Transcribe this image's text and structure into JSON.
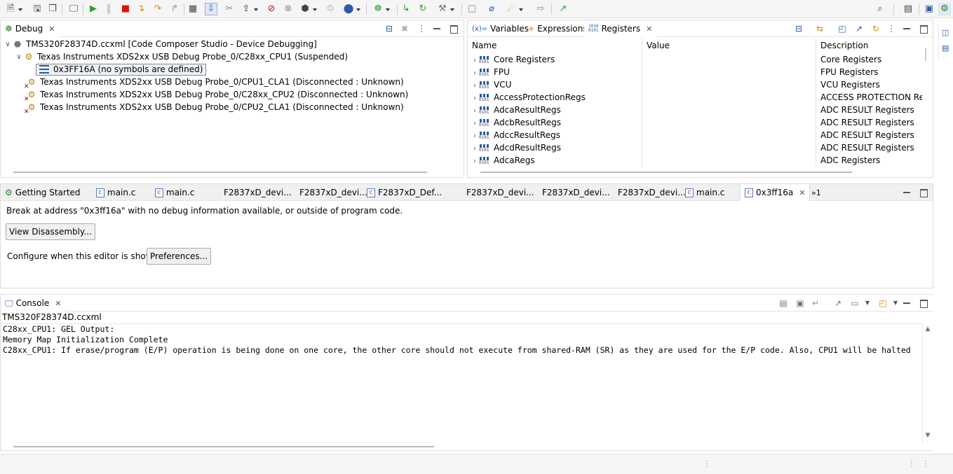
{
  "colors": {
    "accent": "#2a5aa8",
    "pane_border": "#dcdcdc",
    "toolbar_bg": "#f5f5f5",
    "editor_tab_bg": "#f0f0f0"
  },
  "debug": {
    "tab_label": "Debug",
    "root": "TMS320F28374D.ccxml [Code Composer Studio - Device Debugging]",
    "cpu1": "Texas Instruments XDS2xx USB Debug Probe_0/C28xx_CPU1 (Suspended)",
    "frame": "0x3FF16A  (no symbols are defined)",
    "cla1": "Texas Instruments XDS2xx USB Debug Probe_0/CPU1_CLA1 (Disconnected : Unknown)",
    "cpu2": "Texas Instruments XDS2xx USB Debug Probe_0/C28xx_CPU2 (Disconnected : Unknown)",
    "cla2": "Texas Instruments XDS2xx USB Debug Probe_0/CPU2_CLA1 (Disconnected : Unknown)"
  },
  "views": {
    "variables_tab": "Variables",
    "expressions_tab": "Expressions",
    "registers_tab": "Registers",
    "variables_icon_text": "(x)=",
    "registers_icon_text": "1010\n0101",
    "columns": {
      "name": "Name",
      "value": "Value",
      "description": "Description"
    },
    "rows": [
      {
        "name": "Core Registers",
        "value": "",
        "description": "Core Registers"
      },
      {
        "name": "FPU",
        "value": "",
        "description": "FPU Registers"
      },
      {
        "name": "VCU",
        "value": "",
        "description": "VCU Registers"
      },
      {
        "name": "AccessProtectionRegs",
        "value": "",
        "description": "ACCESS PROTECTION Registers"
      },
      {
        "name": "AdcaResultRegs",
        "value": "",
        "description": "ADC RESULT Registers"
      },
      {
        "name": "AdcbResultRegs",
        "value": "",
        "description": "ADC RESULT Registers"
      },
      {
        "name": "AdccResultRegs",
        "value": "",
        "description": "ADC RESULT Registers"
      },
      {
        "name": "AdcdResultRegs",
        "value": "",
        "description": "ADC RESULT Registers"
      },
      {
        "name": "AdcaRegs",
        "value": "",
        "description": "ADC Registers"
      }
    ]
  },
  "editor": {
    "tabs": [
      {
        "label": "Getting Started",
        "icon": "getting-started-icon"
      },
      {
        "label": "main.c",
        "icon": "c-file-icon"
      },
      {
        "label": "main.c",
        "icon": "c-file-icon"
      },
      {
        "label": "F2837xD_devi...",
        "icon": ""
      },
      {
        "label": "F2837xD_devi...",
        "icon": ""
      },
      {
        "label": "F2837xD_Def...",
        "icon": "c-file-icon"
      },
      {
        "label": "F2837xD_devi...",
        "icon": ""
      },
      {
        "label": "F2837xD_devi...",
        "icon": ""
      },
      {
        "label": "F2837xD_devi...",
        "icon": ""
      },
      {
        "label": "main.c",
        "icon": "c-file-icon"
      },
      {
        "label": "0x3ff16a",
        "icon": "c-file-icon"
      }
    ],
    "overflow_label": "»1",
    "c_glyph": "c",
    "message": "Break at address \"0x3ff16a\" with no debug information available, or outside of program code.",
    "view_disassembly": "View Disassembly...",
    "configure_text": "Configure when this editor is shown",
    "preferences": "Preferences..."
  },
  "console": {
    "tab_label": "Console",
    "subtitle": "TMS320F28374D.ccxml",
    "lines": [
      "C28xx_CPU1: GEL Output:",
      "Memory Map Initialization Complete",
      "C28xx_CPU1: If erase/program (E/P) operation is being done on one core, the other core should not execute from shared-RAM (SR) as they are used for the E/P code. Also, CPU1 will be halted"
    ]
  }
}
